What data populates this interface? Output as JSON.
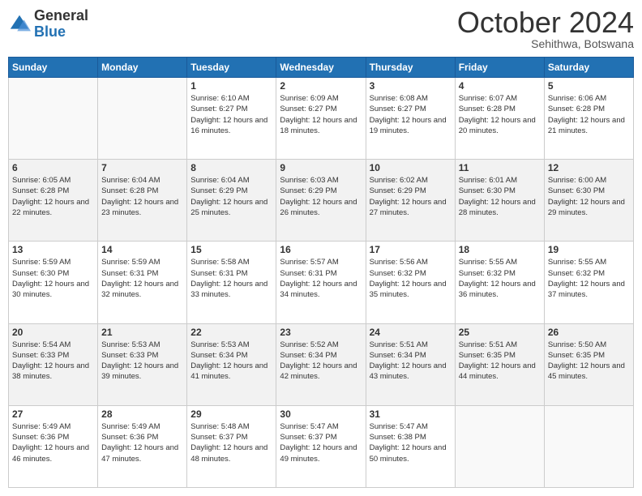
{
  "header": {
    "logo_general": "General",
    "logo_blue": "Blue",
    "month_title": "October 2024",
    "subtitle": "Sehithwa, Botswana"
  },
  "days_of_week": [
    "Sunday",
    "Monday",
    "Tuesday",
    "Wednesday",
    "Thursday",
    "Friday",
    "Saturday"
  ],
  "weeks": [
    [
      {
        "day": "",
        "info": ""
      },
      {
        "day": "",
        "info": ""
      },
      {
        "day": "1",
        "info": "Sunrise: 6:10 AM\nSunset: 6:27 PM\nDaylight: 12 hours and 16 minutes."
      },
      {
        "day": "2",
        "info": "Sunrise: 6:09 AM\nSunset: 6:27 PM\nDaylight: 12 hours and 18 minutes."
      },
      {
        "day": "3",
        "info": "Sunrise: 6:08 AM\nSunset: 6:27 PM\nDaylight: 12 hours and 19 minutes."
      },
      {
        "day": "4",
        "info": "Sunrise: 6:07 AM\nSunset: 6:28 PM\nDaylight: 12 hours and 20 minutes."
      },
      {
        "day": "5",
        "info": "Sunrise: 6:06 AM\nSunset: 6:28 PM\nDaylight: 12 hours and 21 minutes."
      }
    ],
    [
      {
        "day": "6",
        "info": "Sunrise: 6:05 AM\nSunset: 6:28 PM\nDaylight: 12 hours and 22 minutes."
      },
      {
        "day": "7",
        "info": "Sunrise: 6:04 AM\nSunset: 6:28 PM\nDaylight: 12 hours and 23 minutes."
      },
      {
        "day": "8",
        "info": "Sunrise: 6:04 AM\nSunset: 6:29 PM\nDaylight: 12 hours and 25 minutes."
      },
      {
        "day": "9",
        "info": "Sunrise: 6:03 AM\nSunset: 6:29 PM\nDaylight: 12 hours and 26 minutes."
      },
      {
        "day": "10",
        "info": "Sunrise: 6:02 AM\nSunset: 6:29 PM\nDaylight: 12 hours and 27 minutes."
      },
      {
        "day": "11",
        "info": "Sunrise: 6:01 AM\nSunset: 6:30 PM\nDaylight: 12 hours and 28 minutes."
      },
      {
        "day": "12",
        "info": "Sunrise: 6:00 AM\nSunset: 6:30 PM\nDaylight: 12 hours and 29 minutes."
      }
    ],
    [
      {
        "day": "13",
        "info": "Sunrise: 5:59 AM\nSunset: 6:30 PM\nDaylight: 12 hours and 30 minutes."
      },
      {
        "day": "14",
        "info": "Sunrise: 5:59 AM\nSunset: 6:31 PM\nDaylight: 12 hours and 32 minutes."
      },
      {
        "day": "15",
        "info": "Sunrise: 5:58 AM\nSunset: 6:31 PM\nDaylight: 12 hours and 33 minutes."
      },
      {
        "day": "16",
        "info": "Sunrise: 5:57 AM\nSunset: 6:31 PM\nDaylight: 12 hours and 34 minutes."
      },
      {
        "day": "17",
        "info": "Sunrise: 5:56 AM\nSunset: 6:32 PM\nDaylight: 12 hours and 35 minutes."
      },
      {
        "day": "18",
        "info": "Sunrise: 5:55 AM\nSunset: 6:32 PM\nDaylight: 12 hours and 36 minutes."
      },
      {
        "day": "19",
        "info": "Sunrise: 5:55 AM\nSunset: 6:32 PM\nDaylight: 12 hours and 37 minutes."
      }
    ],
    [
      {
        "day": "20",
        "info": "Sunrise: 5:54 AM\nSunset: 6:33 PM\nDaylight: 12 hours and 38 minutes."
      },
      {
        "day": "21",
        "info": "Sunrise: 5:53 AM\nSunset: 6:33 PM\nDaylight: 12 hours and 39 minutes."
      },
      {
        "day": "22",
        "info": "Sunrise: 5:53 AM\nSunset: 6:34 PM\nDaylight: 12 hours and 41 minutes."
      },
      {
        "day": "23",
        "info": "Sunrise: 5:52 AM\nSunset: 6:34 PM\nDaylight: 12 hours and 42 minutes."
      },
      {
        "day": "24",
        "info": "Sunrise: 5:51 AM\nSunset: 6:34 PM\nDaylight: 12 hours and 43 minutes."
      },
      {
        "day": "25",
        "info": "Sunrise: 5:51 AM\nSunset: 6:35 PM\nDaylight: 12 hours and 44 minutes."
      },
      {
        "day": "26",
        "info": "Sunrise: 5:50 AM\nSunset: 6:35 PM\nDaylight: 12 hours and 45 minutes."
      }
    ],
    [
      {
        "day": "27",
        "info": "Sunrise: 5:49 AM\nSunset: 6:36 PM\nDaylight: 12 hours and 46 minutes."
      },
      {
        "day": "28",
        "info": "Sunrise: 5:49 AM\nSunset: 6:36 PM\nDaylight: 12 hours and 47 minutes."
      },
      {
        "day": "29",
        "info": "Sunrise: 5:48 AM\nSunset: 6:37 PM\nDaylight: 12 hours and 48 minutes."
      },
      {
        "day": "30",
        "info": "Sunrise: 5:47 AM\nSunset: 6:37 PM\nDaylight: 12 hours and 49 minutes."
      },
      {
        "day": "31",
        "info": "Sunrise: 5:47 AM\nSunset: 6:38 PM\nDaylight: 12 hours and 50 minutes."
      },
      {
        "day": "",
        "info": ""
      },
      {
        "day": "",
        "info": ""
      }
    ]
  ]
}
